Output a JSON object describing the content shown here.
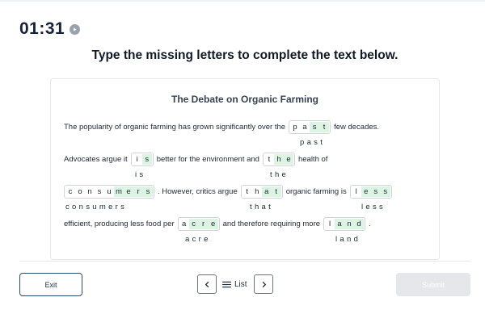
{
  "timer": {
    "value": "01:31",
    "icon": "play-circle-icon"
  },
  "instructions": "Type the missing letters to complete the text below.",
  "passage": {
    "title": "The Debate on Organic Farming",
    "lines": [
      {
        "t1": "The popularity of organic farming has grown significantly over the",
        "w1": {
          "given": "pa",
          "typed": "st"
        },
        "t2": "few decades."
      },
      {
        "t1": "Advocates argue it",
        "w1": {
          "given": "i",
          "typed": "s"
        },
        "t2": "better for the environment and",
        "w2": {
          "given": "t",
          "typed": "he"
        },
        "t3": "health of"
      },
      {
        "w1": {
          "given": "consu",
          "typed": "mers"
        },
        "t1": ". However, critics argue",
        "w2": {
          "given": "th",
          "typed": "at"
        },
        "t2": "organic farming is",
        "w3": {
          "given": "l",
          "typed": "ess"
        }
      },
      {
        "t1": "efficient, producing less food per",
        "w1": {
          "given": "a",
          "typed": "cre"
        },
        "t2": "and therefore requiring more",
        "w2": {
          "given": "l",
          "typed": "and"
        },
        "t3": "."
      }
    ],
    "answers": [
      "past",
      "is",
      "the",
      "consumers",
      "that",
      "less",
      "acre",
      "land"
    ]
  },
  "footer": {
    "exit_label": "Exit",
    "list_label": "List",
    "submit_label": "Submit",
    "icons": {
      "prev": "chevron-left-icon",
      "next": "chevron-right-icon",
      "list": "list-icon"
    }
  },
  "colors": {
    "typed_fill": "#dcf5e3",
    "submit_disabled": "#e5e7eb",
    "exit_border": "#2f4a6b"
  }
}
